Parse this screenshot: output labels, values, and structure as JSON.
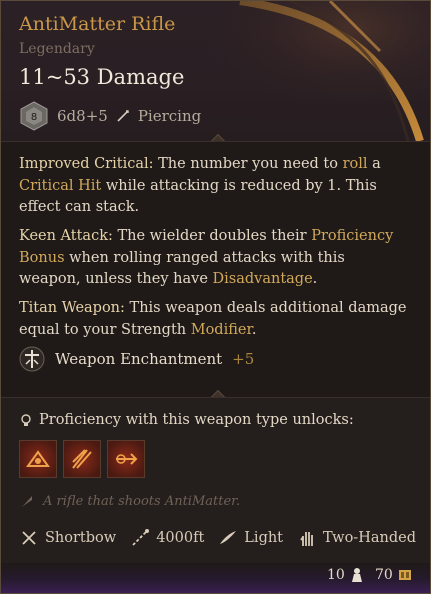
{
  "item": {
    "name": "AntiMatter Rifle",
    "rarity": "Legendary",
    "damage": "11~53 Damage",
    "die_label": "8",
    "dice": "6d8+5",
    "damage_type": "Piercing"
  },
  "effects": {
    "improved_critical": {
      "name": "Improved Critical:",
      "text1": " The number you need to ",
      "roll": "roll",
      "text2": " a",
      "critical_hit": "Critical Hit",
      "text3": " while attacking is reduced by 1. This effect can stack."
    },
    "keen_attack": {
      "name": "Keen Attack:",
      "text1": " The wielder doubles their ",
      "proficiency_bonus": "Proficiency Bonus",
      "text2": " when rolling ranged attacks with this weapon, unless they have ",
      "disadvantage": "Disadvantage",
      "text3": "."
    },
    "titan_weapon": {
      "name": "Titan Weapon:",
      "text1": " This weapon deals additional damage equal to your Strength ",
      "modifier": "Modifier",
      "text2": "."
    }
  },
  "enchantment": {
    "label": "Weapon Enchantment",
    "bonus": "+5"
  },
  "proficiency": {
    "label": "Proficiency with this weapon type unlocks:"
  },
  "actions": [
    "action-1",
    "action-2",
    "action-3"
  ],
  "flavor_text": "A rifle that shoots AntiMatter.",
  "properties": {
    "type": "Shortbow",
    "range": "4000ft",
    "weight_class": "Light",
    "handedness": "Two-Handed"
  },
  "footer": {
    "weight": "10",
    "price": "70"
  },
  "colors": {
    "legendary": "#c9974a",
    "keyword": "#d2a95b",
    "footer_purple": "#3a1f52"
  }
}
